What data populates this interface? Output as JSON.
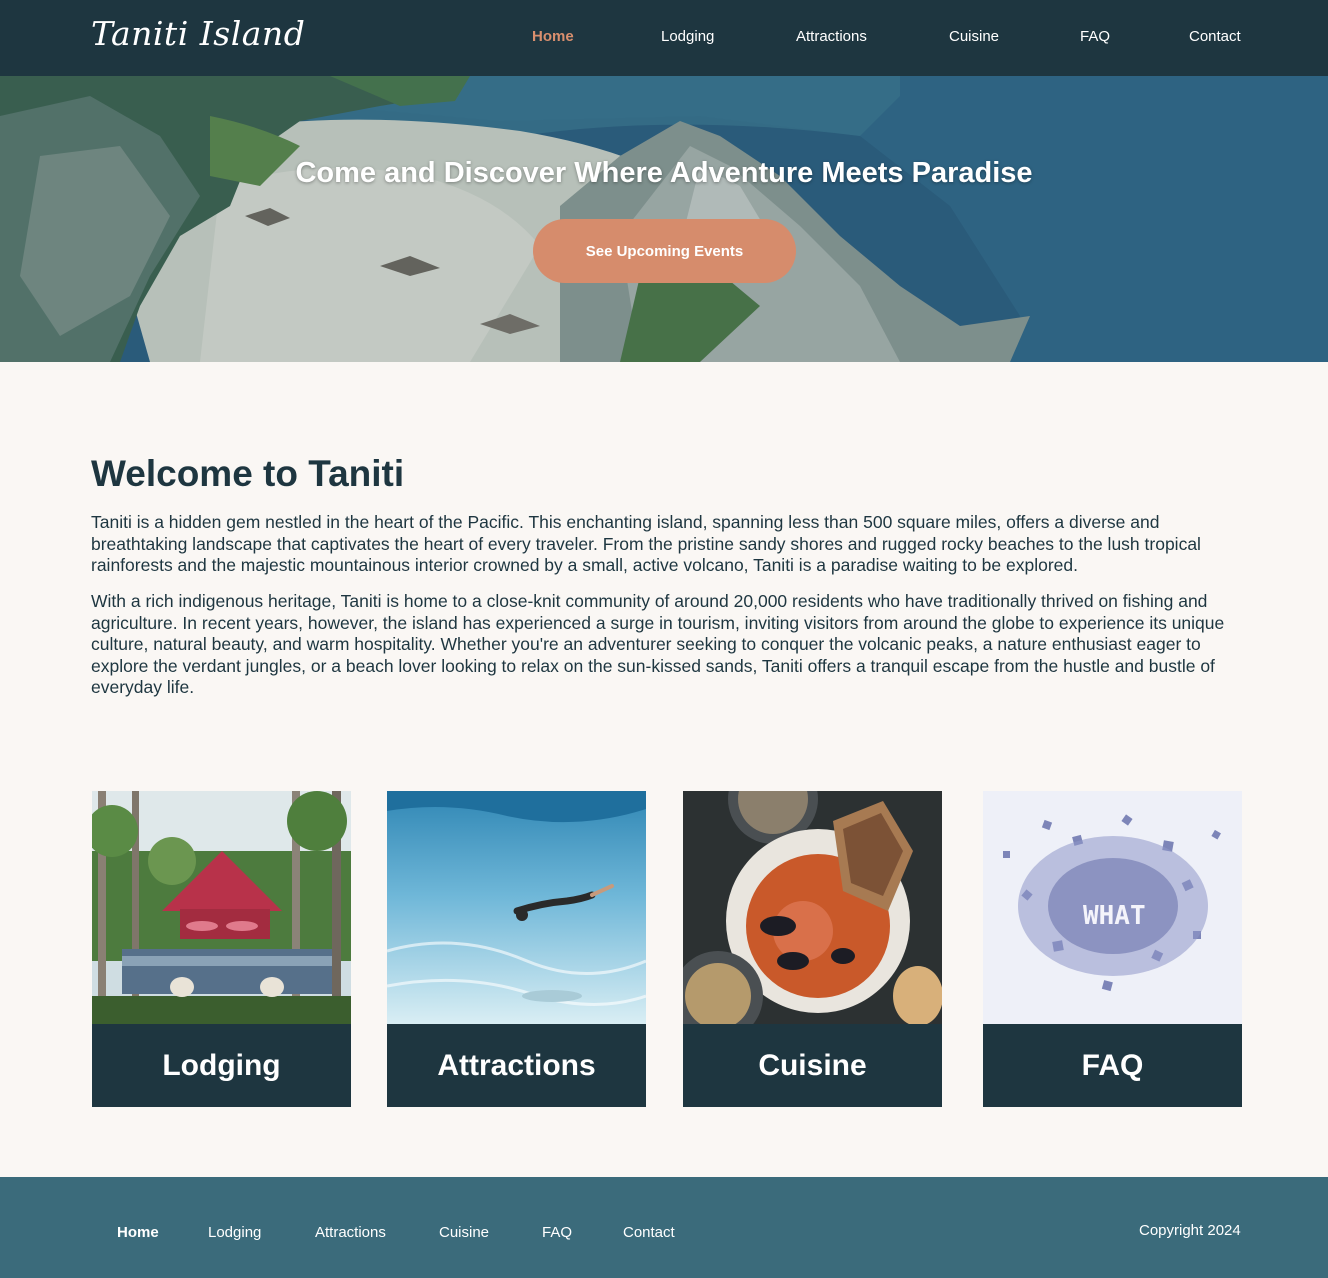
{
  "brand": {
    "logo_text": "Taniti Island"
  },
  "nav": {
    "home": "Home",
    "lodging": "Lodging",
    "attractions": "Attractions",
    "cuisine": "Cuisine",
    "faq": "FAQ",
    "contact": "Contact"
  },
  "hero": {
    "title": "Come and Discover Where Adventure Meets Paradise",
    "button_label": "See Upcoming Events"
  },
  "welcome": {
    "title": "Welcome to Taniti",
    "paragraph_1": "Taniti is a hidden gem nestled in the heart of the Pacific. This enchanting island, spanning less than 500 square miles, offers a diverse and breathtaking landscape that captivates the heart of every traveler. From the pristine sandy shores and rugged rocky beaches to the lush tropical rainforests and the majestic mountainous interior crowned by a small, active volcano, Taniti is a paradise waiting to be explored.",
    "paragraph_2": "With a rich indigenous heritage, Taniti is home to a close-knit community of around 20,000 residents who have traditionally thrived on fishing and agriculture. In recent years, however, the island has experienced a surge in tourism, inviting visitors from around the globe to experience its unique culture, natural beauty, and warm hospitality. Whether you're an adventurer seeking to conquer the volcanic peaks, a nature enthusiast eager to explore the verdant jungles, or a beach lover looking to relax on the sun-kissed sands, Taniti offers a tranquil escape from the hustle and bustle of everyday life."
  },
  "cards": {
    "lodging": {
      "label": "Lodging"
    },
    "attractions": {
      "label": "Attractions"
    },
    "cuisine": {
      "label": "Cuisine"
    },
    "faq": {
      "label": "FAQ",
      "image_text": "WHAT"
    }
  },
  "footer": {
    "nav": {
      "home": "Home",
      "lodging": "Lodging",
      "attractions": "Attractions",
      "cuisine": "Cuisine",
      "faq": "FAQ",
      "contact": "Contact"
    },
    "copyright": "Copyright 2024"
  },
  "colors": {
    "header_bg": "#1e3640",
    "accent": "#d68c6c",
    "page_bg": "#faf7f4",
    "footer_bg": "#3b6b7b"
  }
}
